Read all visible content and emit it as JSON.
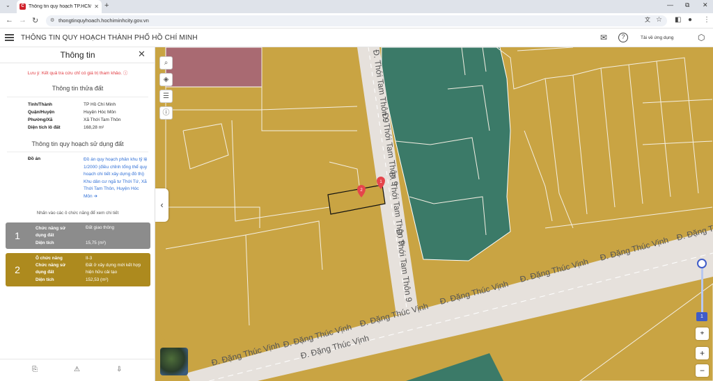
{
  "browser": {
    "tab_title": "Thông tin quy hoạch TP.HCM",
    "tab_favicon": "C",
    "new_tab": "+",
    "url": "thongtinquyhoach.hochiminhcity.gov.vn"
  },
  "app": {
    "title": "THÔNG TIN QUY HOẠCH THÀNH PHỐ HỒ CHÍ MINH",
    "download_label": "Tải về ứng dụng"
  },
  "panel": {
    "title": "Thông tin",
    "note": "Lưu ý: Kết quả tra cứu chỉ có giá trị tham khảo.",
    "parcel_section_title": "Thông tin thửa đất",
    "parcel": [
      {
        "key": "Tỉnh/Thành",
        "value": "TP Hồ Chí Minh"
      },
      {
        "key": "Quận/Huyện",
        "value": "Huyện Hóc Môn"
      },
      {
        "key": "Phường/Xã",
        "value": "Xã Thới Tam Thôn"
      },
      {
        "key": "Diện tích lô đất",
        "value": "168,28 m²"
      }
    ],
    "planning_section_title": "Thông tin quy hoạch sử dụng đất",
    "doan_label": "Đồ án",
    "doan_link": "Đồ án quy hoạch phân khu tỷ lệ 1/2000 (điều chỉnh tổng thể quy hoạch chi tiết xây dựng đô thị) Khu dân cư ngã tư Thới Tứ, Xã Thới Tam Thôn, Huyện Hóc Môn ➔",
    "hint": "Nhấn vào các ô chức năng để xem chi tiết",
    "cards": [
      {
        "number": "1",
        "color": "#8c8c8c",
        "rows": [
          {
            "key": "Chức năng sử dụng đất",
            "value": "Đất giao thông"
          },
          {
            "key": "Diện tích",
            "value": "15,75 (m²)"
          }
        ]
      },
      {
        "number": "2",
        "color": "#ad8a1e",
        "rows": [
          {
            "key": "Ô chức năng",
            "value": "II-3"
          },
          {
            "key": "Chức năng sử dụng đất",
            "value": "Đất ở xây dựng mới kết hợp hiện hữu cải tạo"
          },
          {
            "key": "Diện tích",
            "value": "152,53 (m²)"
          }
        ]
      }
    ]
  },
  "map": {
    "streets": {
      "vertical": "Đ. Thới Tam Thôn 9",
      "horizontal": "Đ. Đặng Thúc Vịnh"
    },
    "markers": [
      "1",
      "2"
    ],
    "zoom_level": "1",
    "colors": {
      "residential": "#c9a443",
      "green": "#3b7a68",
      "pink": "#a96a72",
      "road": "#e6e1dc",
      "marker": "#e5454b",
      "accent": "#3f5cc8"
    }
  }
}
